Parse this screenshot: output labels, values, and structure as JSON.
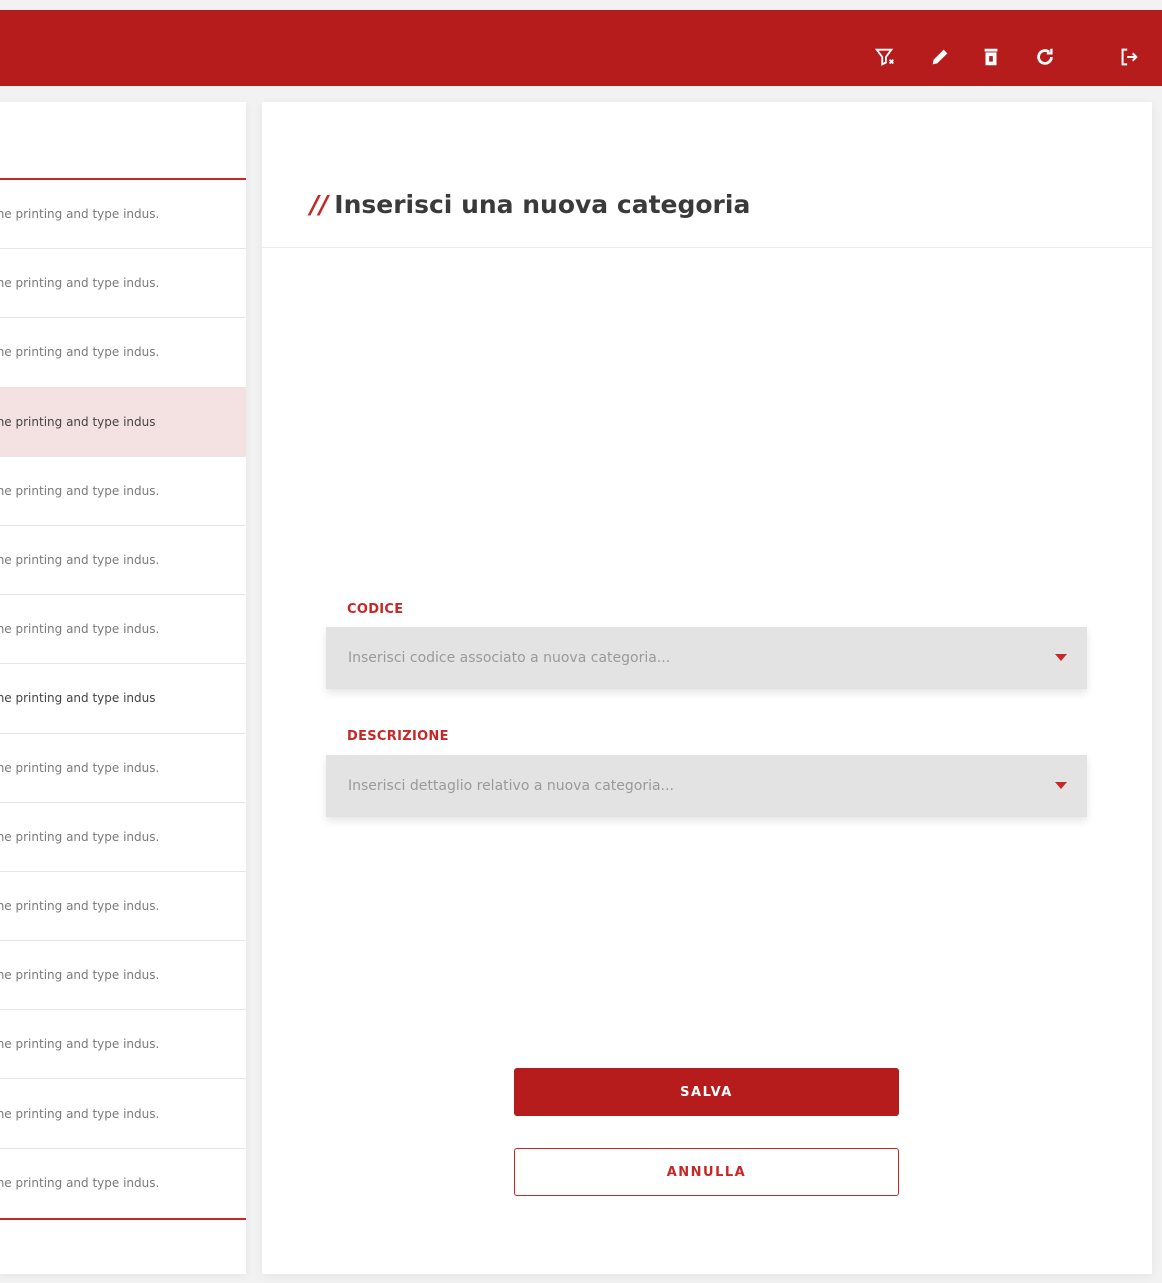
{
  "toolbar": {
    "icons": [
      "filter-clear-icon",
      "pencil-icon",
      "trash-icon",
      "refresh-icon",
      "logout-icon"
    ],
    "color": "#b71c1c"
  },
  "list": {
    "items": [
      {
        "text": "the printing and type indus."
      },
      {
        "text": "the printing and type indus."
      },
      {
        "text": "the printing and type indus."
      },
      {
        "text": "the printing and type indus"
      },
      {
        "text": "the printing and type indus."
      },
      {
        "text": "the printing and type indus."
      },
      {
        "text": "the printing and type indus."
      },
      {
        "text": "the printing and type indus"
      },
      {
        "text": "the printing and type indus."
      },
      {
        "text": "the printing and type indus."
      },
      {
        "text": "the printing and type indus."
      },
      {
        "text": "the printing and type indus."
      },
      {
        "text": "the printing and type indus."
      },
      {
        "text": "the printing and type indus."
      },
      {
        "text": "the printing and type indus."
      }
    ]
  },
  "form": {
    "slashes": "//",
    "title": "Inserisci una nuova categoria",
    "codice": {
      "label": "CODICE",
      "placeholder": "Inserisci codice associato a nuova categoria..."
    },
    "descrizione": {
      "label": "DESCRIZIONE",
      "placeholder": "Inserisci dettaglio relativo a nuova categoria..."
    },
    "save_label": "SALVA",
    "cancel_label": "ANNULLA"
  }
}
